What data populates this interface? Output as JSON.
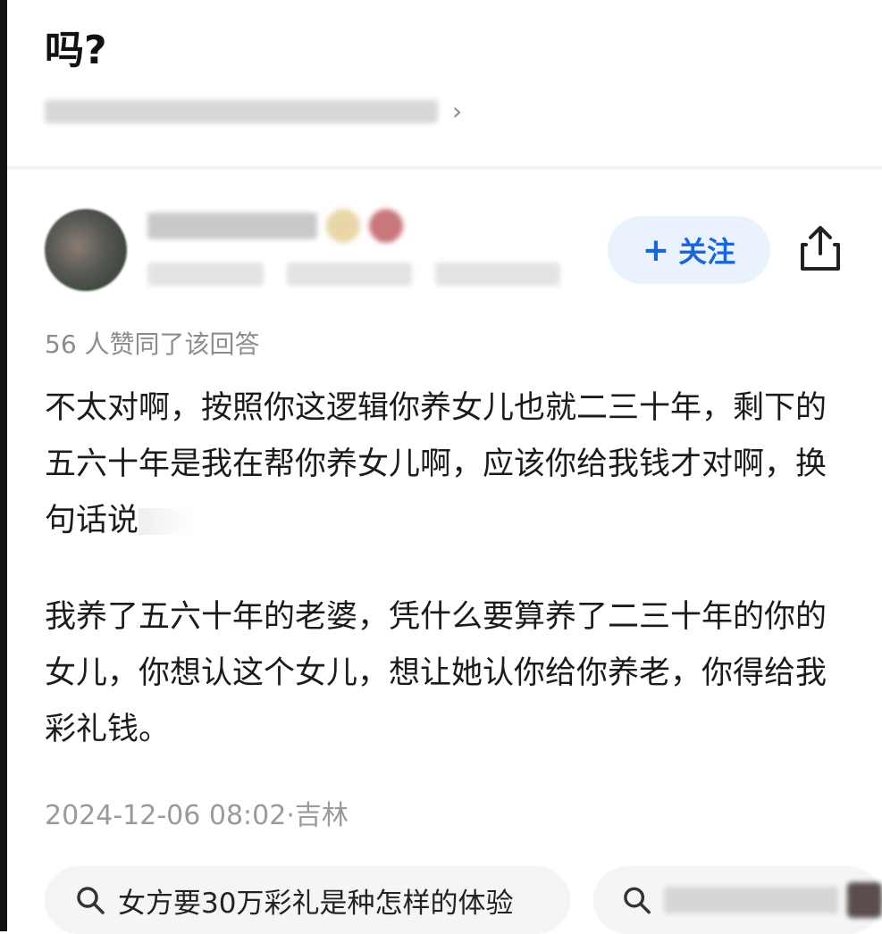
{
  "question": {
    "title": "吗?"
  },
  "answer": {
    "likes_text": "56 人赞同了该回答",
    "paragraphs": [
      "不太对啊，按照你这逻辑你养女儿也就二三十年，剩下的五六十年是我在帮你养女儿啊，应该你给我钱才对啊，换句话说",
      "我养了五六十年的老婆，凭什么要算养了二三十年的你的女儿，你想认这个女儿，想让她认你给你养老，你得给我彩礼钱。"
    ],
    "timestamp": "2024-12-06 08:02·吉林"
  },
  "author": {
    "follow_label": "关注",
    "follow_plus": "+"
  },
  "related_searches": [
    "女方要30万彩礼是种怎样的体验"
  ],
  "icons": {
    "share": "share-icon",
    "search": "search-icon",
    "chevron": "chevron-right-icon"
  },
  "colors": {
    "accent": "#1a66d9",
    "follow_bg": "#eaf2fd",
    "muted": "#8c8c8c"
  }
}
